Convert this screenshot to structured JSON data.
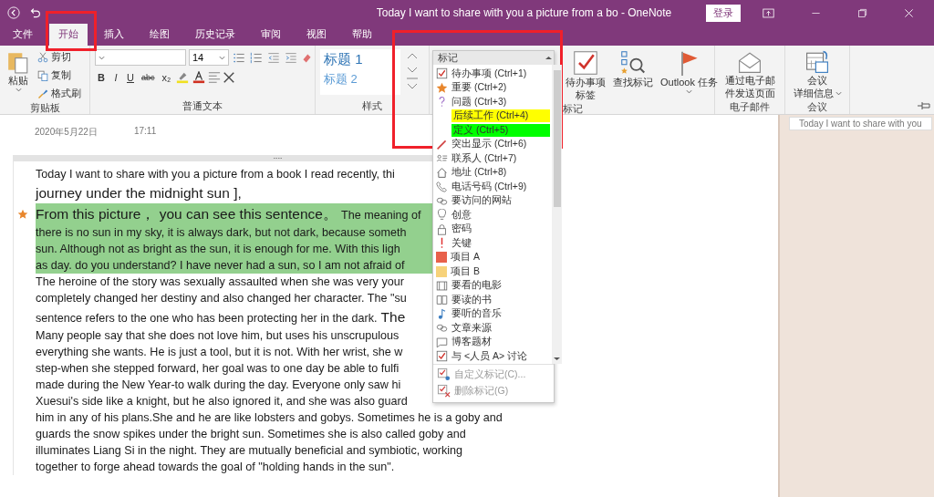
{
  "window": {
    "title": "Today I want to share with you a picture from a bo  -  OneNote",
    "sign_in": "登录"
  },
  "tabs": [
    {
      "label": "文件",
      "selected": false
    },
    {
      "label": "开始",
      "selected": true
    },
    {
      "label": "插入",
      "selected": false
    },
    {
      "label": "绘图",
      "selected": false
    },
    {
      "label": "历史记录",
      "selected": false
    },
    {
      "label": "审阅",
      "selected": false
    },
    {
      "label": "视图",
      "selected": false
    },
    {
      "label": "帮助",
      "selected": false
    }
  ],
  "ribbon": {
    "clipboard": {
      "paste": "粘贴",
      "items": [
        "剪切",
        "复制",
        "格式刷"
      ],
      "label": "剪贴板"
    },
    "basic_text": {
      "font_size": "14",
      "format_buttons": [
        "B",
        "I",
        "U",
        "abc",
        "x₂"
      ],
      "label": "普通文本"
    },
    "styles": {
      "items": [
        "标题 1",
        "标题 2"
      ],
      "label": "样式"
    },
    "tags": {
      "buttons": [
        {
          "kind": "checkbox",
          "lines": [
            "待办事项",
            "标签"
          ]
        },
        {
          "kind": "find",
          "lines": [
            "查找标记"
          ]
        },
        {
          "kind": "flag",
          "lines": [
            "Outlook 任务"
          ]
        }
      ],
      "label": "标记"
    },
    "email": {
      "lines": [
        "通过电子邮",
        "件发送页面"
      ],
      "label": "电子邮件"
    },
    "meeting": {
      "lines": [
        "会议",
        "详细信息"
      ],
      "label": "会议"
    }
  },
  "tags_menu": {
    "header": "标记",
    "items": [
      {
        "label": "待办事项 (Ctrl+1)",
        "kind": "checkbox"
      },
      {
        "label": "重要 (Ctrl+2)",
        "kind": "star"
      },
      {
        "label": "问题 (Ctrl+3)",
        "kind": "question"
      },
      {
        "label": "后续工作 (Ctrl+4)",
        "kind": "highlight",
        "color": "#ffff00"
      },
      {
        "label": "定义 (Ctrl+5)",
        "kind": "highlight",
        "color": "#00ff00"
      },
      {
        "label": "突出显示 (Ctrl+6)",
        "kind": "pen"
      },
      {
        "label": "联系人 (Ctrl+7)",
        "kind": "contact"
      },
      {
        "label": "地址 (Ctrl+8)",
        "kind": "home"
      },
      {
        "label": "电话号码 (Ctrl+9)",
        "kind": "phone"
      },
      {
        "label": "要访问的网站",
        "kind": "link"
      },
      {
        "label": "创意",
        "kind": "bulb"
      },
      {
        "label": "密码",
        "kind": "lock"
      },
      {
        "label": "关键",
        "kind": "exclaim"
      },
      {
        "label": "项目 A",
        "kind": "square",
        "color": "#e8604a"
      },
      {
        "label": "项目 B",
        "kind": "square",
        "color": "#f7d27a"
      },
      {
        "label": "要看的电影",
        "kind": "film"
      },
      {
        "label": "要读的书",
        "kind": "book"
      },
      {
        "label": "要听的音乐",
        "kind": "note"
      },
      {
        "label": "文章来源",
        "kind": "link"
      },
      {
        "label": "博客题材",
        "kind": "speech"
      },
      {
        "label": "与 <人员 A> 讨论",
        "kind": "checkbox"
      }
    ],
    "footer": [
      {
        "label": "自定义标记(C)...",
        "kind": "gear",
        "disabled": true
      },
      {
        "label": "删除标记(G)",
        "kind": "remove",
        "disabled": true
      }
    ]
  },
  "note": {
    "date": "2020年5月22日",
    "time": "17:11",
    "lines": [
      {
        "highlighted": false,
        "starred": false,
        "parts": [
          {
            "text": "Today I want to share with you a picture from a book I read recently, thi",
            "large": false
          }
        ]
      },
      {
        "highlighted": false,
        "starred": false,
        "parts": [
          {
            "text": "journey under the midnight sun ],",
            "large": true
          }
        ]
      },
      {
        "highlighted": true,
        "starred": true,
        "parts": [
          {
            "text": "From this picture， you can see this sentence。",
            "large": true
          },
          {
            "text": "The meaning of",
            "large": false
          }
        ]
      },
      {
        "highlighted": true,
        "starred": false,
        "parts": [
          {
            "text": "there is no sun in my sky, it is always dark, but not dark, because someth",
            "large": false
          }
        ]
      },
      {
        "highlighted": true,
        "starred": false,
        "parts": [
          {
            "text": "sun. Although not as bright as the sun, it is enough for me. With this ligh",
            "large": false
          }
        ]
      },
      {
        "highlighted": true,
        "starred": false,
        "parts": [
          {
            "text": "as day. do you understand? I have never had a sun, so I am not afraid of",
            "large": false
          }
        ]
      },
      {
        "highlighted": false,
        "starred": false,
        "parts": [
          {
            "text": "The heroine of the story was sexually assaulted when she was very your",
            "large": false
          }
        ]
      },
      {
        "highlighted": false,
        "starred": false,
        "parts": [
          {
            "text": "completely changed her destiny and also changed her character. The \"su",
            "large": false
          }
        ]
      },
      {
        "highlighted": false,
        "starred": false,
        "parts": [
          {
            "text": "sentence refers to the one who has been protecting her in the dark.",
            "large": false
          },
          {
            "text": "The",
            "large": true
          }
        ]
      },
      {
        "highlighted": false,
        "starred": false,
        "parts": [
          {
            "text": "Many people say that she does not love him, but uses his unscrupulous",
            "large": false
          }
        ]
      },
      {
        "highlighted": false,
        "starred": false,
        "parts": [
          {
            "text": "everything she wants. He is just a tool, but it is not. With her wrist, she w",
            "large": false
          }
        ]
      },
      {
        "highlighted": false,
        "starred": false,
        "parts": [
          {
            "text": "step-when she stepped forward, her goal was to one day be able to fulfi",
            "large": false
          }
        ]
      },
      {
        "highlighted": false,
        "starred": false,
        "parts": [
          {
            "text": "made during the New Year-to walk during the day. Everyone only saw hi",
            "large": false
          }
        ]
      },
      {
        "highlighted": false,
        "starred": false,
        "parts": [
          {
            "text": "Xuesui's side like a knight, but he also ignored it, and she was also guard",
            "large": false
          }
        ]
      },
      {
        "highlighted": false,
        "starred": false,
        "parts": [
          {
            "text": "him in any of his plans.She and he are like lobsters and gobys. Sometimes he is a goby and",
            "large": false
          }
        ]
      },
      {
        "highlighted": false,
        "starred": false,
        "parts": [
          {
            "text": "guards the snow spikes under the bright sun. Sometimes she is also called goby and",
            "large": false
          }
        ]
      },
      {
        "highlighted": false,
        "starred": false,
        "parts": [
          {
            "text": "illuminates Liang Si in the night. They are mutually beneficial and symbiotic, working",
            "large": false
          }
        ]
      },
      {
        "highlighted": false,
        "starred": false,
        "parts": [
          {
            "text": "together to forge ahead towards the goal of \"holding hands in the sun\".",
            "large": false
          }
        ]
      }
    ]
  },
  "pages": [
    {
      "title": "Today I want to share with you"
    }
  ]
}
